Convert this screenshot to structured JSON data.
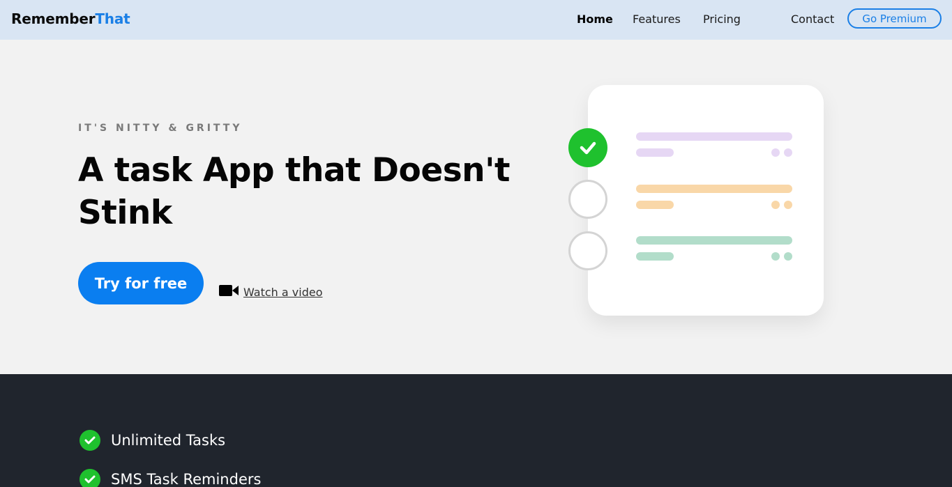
{
  "header": {
    "brand_primary": "Remember",
    "brand_accent": "That",
    "nav": [
      "Home",
      "Features",
      "Pricing",
      "Contact"
    ],
    "premium_label": "Go Premium"
  },
  "hero": {
    "eyebrow": "IT'S NITTY & GRITTY",
    "headline": "A task App that Doesn't Stink",
    "cta_label": "Try for free",
    "video_label": "Watch a video"
  },
  "illustration": {
    "tasks": [
      {
        "status": "done",
        "color": "#e6d7f4"
      },
      {
        "status": "todo",
        "color": "#f9d7a8"
      },
      {
        "status": "todo",
        "color": "#b2ddca"
      }
    ]
  },
  "features": {
    "items": [
      "Unlimited Tasks",
      "SMS Task Reminders"
    ]
  },
  "colors": {
    "accent": "#1a7fe6",
    "cta": "#0a7ef0",
    "success": "#1fc12e",
    "header_bg": "#d9e5f3",
    "dark_band": "#20252d"
  },
  "icons": [
    "video-camera-icon",
    "checkmark-icon",
    "check-circle-icon"
  ]
}
